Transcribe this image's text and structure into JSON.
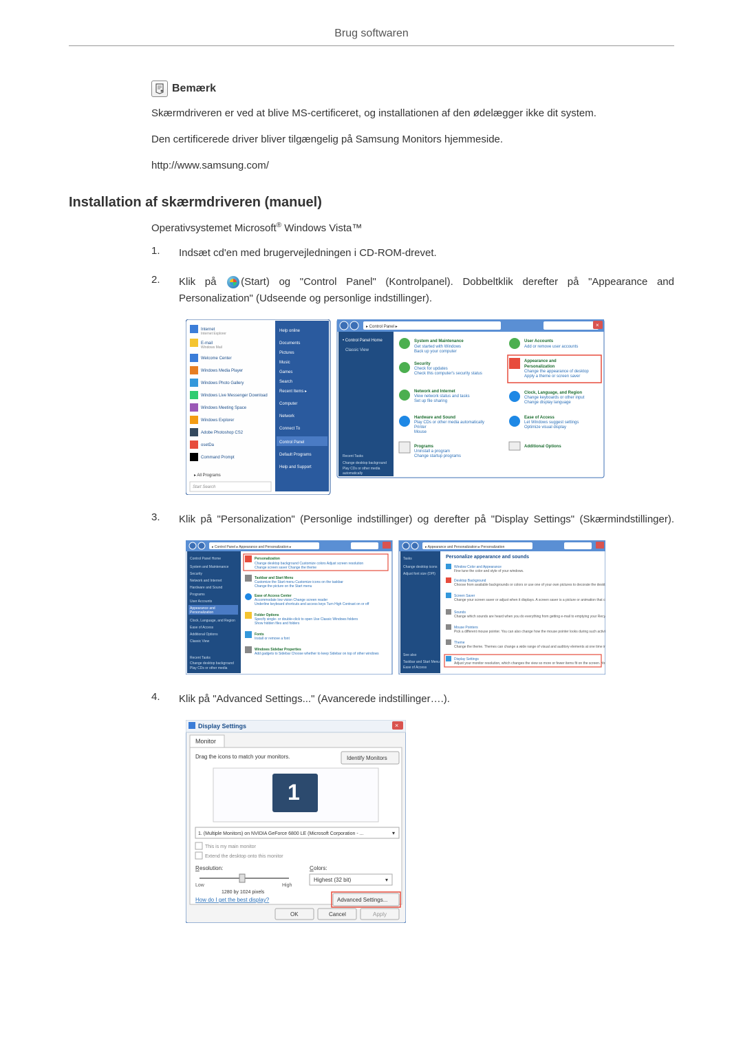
{
  "header": {
    "title": "Brug softwaren"
  },
  "note": {
    "label": "Bemærk",
    "line1": "Skærmdriveren er ved at blive MS-certificeret, og installationen af den ødelægger ikke dit system.",
    "line2": "Den certificerede driver bliver tilgængelig på Samsung Monitors hjemmeside.",
    "url": "http://www.samsung.com/"
  },
  "section": {
    "heading": "Installation af skærmdriveren (manuel)",
    "os_prefix": "Operativsystemet Microsoft",
    "os_suffix": " Windows Vista™",
    "steps": [
      {
        "num": "1.",
        "text": "Indsæt cd'en med brugervejledningen i CD-ROM-drevet."
      },
      {
        "num": "2.",
        "text_before_icon": "Klik på ",
        "text_after_icon": "(Start) og \"Control Panel\" (Kontrolpanel). Dobbeltklik derefter på \"Appearance and Personalization\" (Udseende og personlige indstillinger)."
      },
      {
        "num": "3.",
        "text": "Klik på \"Personalization\" (Personlige indstillinger) og derefter på \"Display Settings\" (Skærmindstillinger)."
      },
      {
        "num": "4.",
        "text": "Klik på \"Advanced Settings...\" (Avancerede indstillinger….)."
      }
    ]
  },
  "screenshots": {
    "start_menu": {
      "items": [
        "Internet",
        "E-mail",
        "Welcome Center",
        "Windows Media Player",
        "Windows Photo Gallery",
        "Windows Live Messenger Download",
        "Windows Meeting Space",
        "Windows Explorer",
        "Adobe Photoshop CS2",
        "osetDa",
        "Command Prompt"
      ],
      "right_items": [
        "Documents",
        "Pictures",
        "Music",
        "Games",
        "Search",
        "Recent Items",
        "Computer",
        "Network",
        "Connect To",
        "Control Panel",
        "Default Programs",
        "Help and Support"
      ],
      "all_programs": "All Programs"
    },
    "control_panel": {
      "breadcrumb": "Control Panel",
      "sidebar": [
        "Control Panel Home",
        "Classic View"
      ],
      "categories": [
        {
          "title": "System and Maintenance",
          "sub": "Get started with Windows"
        },
        {
          "title": "Security",
          "sub": "Check for updates"
        },
        {
          "title": "Network and Internet",
          "sub": "View network status and tasks"
        },
        {
          "title": "Hardware and Sound",
          "sub": "Play CDs or other media automatically"
        },
        {
          "title": "Programs",
          "sub": "Uninstall a program"
        },
        {
          "title": "User Accounts",
          "sub": "Add or remove user accounts"
        },
        {
          "title": "Appearance and Personalization",
          "sub": "Change the appearance of desktop"
        },
        {
          "title": "Clock, Language, and Region",
          "sub": "Change keyboards or other input methods"
        },
        {
          "title": "Ease of Access",
          "sub": "Let Windows suggest settings"
        },
        {
          "title": "Additional Options",
          "sub": ""
        }
      ]
    },
    "appearance_panel": {
      "breadcrumb": "Control Panel > Appearance and Personalization",
      "items": [
        "Personalization",
        "Taskbar and Start Menu",
        "Ease of Access Center",
        "Folder Options",
        "Fonts",
        "Windows Sidebar Properties"
      ]
    },
    "personalization_panel": {
      "breadcrumb": "Appearance and Personalization > Personalization",
      "title": "Personalize appearance and sounds",
      "items": [
        "Window Color and Appearance",
        "Desktop Background",
        "Screen Saver",
        "Sounds",
        "Mouse Pointers",
        "Theme",
        "Display Settings"
      ]
    },
    "display_settings": {
      "title": "Display Settings",
      "tab": "Monitor",
      "instruction": "Drag the icons to match your monitors.",
      "identify_button": "Identify Monitors",
      "monitor_number": "1",
      "dropdown": "1. (Multiple Monitors) on NVIDIA GeForce 6800 LE (Microsoft Corporation - ...",
      "checkbox1": "This is my main monitor",
      "checkbox2": "Extend the desktop onto this monitor",
      "resolution_label": "Resolution:",
      "resolution_low": "Low",
      "resolution_high": "High",
      "resolution_value": "1280 by 1024 pixels",
      "colors_label": "Colors:",
      "colors_value": "Highest (32 bit)",
      "help_link": "How do I get the best display?",
      "advanced_button": "Advanced Settings...",
      "ok": "OK",
      "cancel": "Cancel",
      "apply": "Apply"
    }
  }
}
